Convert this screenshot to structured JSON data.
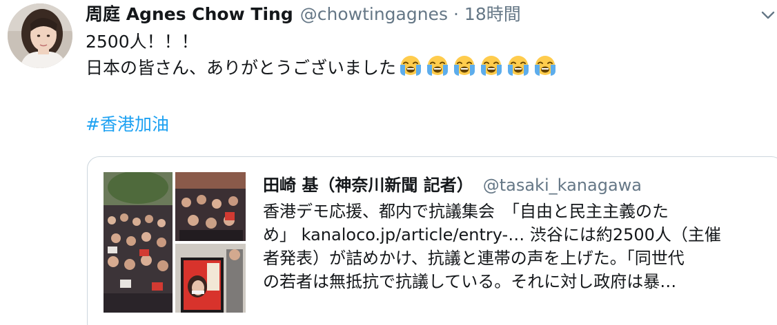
{
  "tweet": {
    "display_name": "周庭 Agnes Chow Ting",
    "handle": "@chowtingagnes",
    "separator": "·",
    "time": "18時間",
    "text_lines": [
      "2500人！！！",
      "日本の皆さん、ありがとうございました"
    ],
    "emoji_name": "loudly-crying-face",
    "emoji_count": 6,
    "hashtag": "#香港加油",
    "caret_icon": "chevron-down-icon"
  },
  "quoted_tweet": {
    "display_name": "田崎 基（神奈川新聞 記者）",
    "handle": "@tasaki_kanagawa",
    "text_lines": [
      "香港デモ応援、都内で抗議集会　「自由と民主主義のた",
      "め」 kanaloco.jp/article/entry-… 渋谷には約2500人（主催",
      "者発表）が詰めかけ、抗議と連帯の声を上げた。「同世代",
      "の若者は無抵抗で抗議している。それに対し政府は暴…"
    ]
  },
  "colors": {
    "text": "#14171a",
    "secondary": "#657786",
    "link": "#1da1f2",
    "border": "#ccd6dd"
  }
}
